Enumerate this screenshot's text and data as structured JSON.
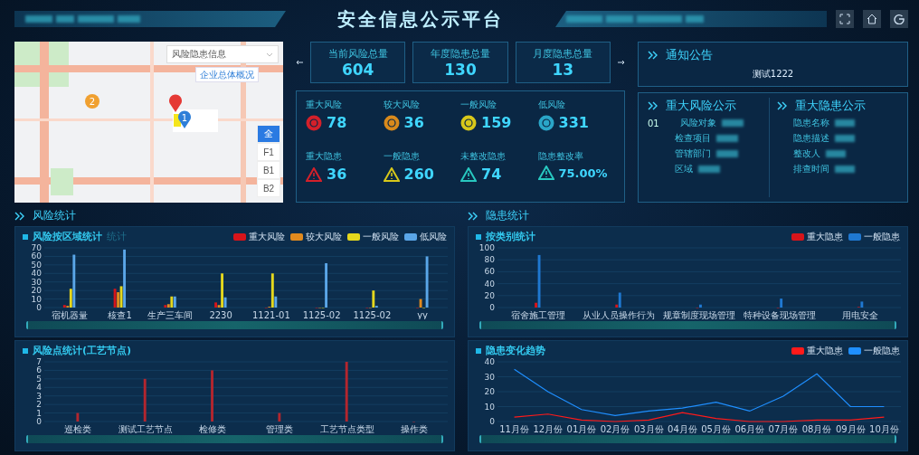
{
  "header": {
    "title": "安全信息公示平台"
  },
  "map": {
    "layer_select": {
      "value": "风险隐患信息"
    },
    "overview_button": "企业总体概况",
    "markers": [
      {
        "kind": "cluster",
        "label": "2",
        "color": "#f0a030"
      },
      {
        "kind": "pin",
        "color": "#e53935"
      },
      {
        "kind": "pin",
        "label": "1",
        "color": "#2f7fd8"
      }
    ],
    "floors": [
      {
        "label": "全",
        "selected": true
      },
      {
        "label": "F1",
        "selected": false
      },
      {
        "label": "B1",
        "selected": false
      },
      {
        "label": "B2",
        "selected": false
      }
    ]
  },
  "totals": [
    {
      "label": "当前风险总量",
      "value": "604"
    },
    {
      "label": "年度隐患总量",
      "value": "130"
    },
    {
      "label": "月度隐患总量",
      "value": "13"
    }
  ],
  "stats": [
    {
      "label": "重大风险",
      "value": "78",
      "kind": "badge",
      "color": "#d4202a"
    },
    {
      "label": "较大风险",
      "value": "36",
      "kind": "badge",
      "color": "#d98a1c"
    },
    {
      "label": "一般风险",
      "value": "159",
      "kind": "badge",
      "color": "#d8c81a"
    },
    {
      "label": "低风险",
      "value": "331",
      "kind": "badge",
      "color": "#2aa6c8"
    },
    {
      "label": "重大隐患",
      "value": "36",
      "kind": "triangle",
      "color": "#d4202a"
    },
    {
      "label": "一般隐患",
      "value": "260",
      "kind": "triangle",
      "color": "#d8c81a"
    },
    {
      "label": "未整改隐患",
      "value": "74",
      "kind": "triangle",
      "color": "#28c8c0"
    },
    {
      "label": "隐患整改率",
      "value": "75.00%",
      "kind": "triangle",
      "color": "#28c8c0"
    }
  ],
  "notice": {
    "title": "通知公告",
    "text": "测试1222"
  },
  "major_risk": {
    "title": "重大风险公示",
    "index": "01",
    "fields": [
      "风险对象",
      "检查项目",
      "管辖部门",
      "区域"
    ]
  },
  "major_hazard": {
    "title": "重大隐患公示",
    "fields": [
      "隐患名称",
      "隐患描述",
      "整改人",
      "排查时间"
    ]
  },
  "sections": [
    {
      "title": "风险统计",
      "panels": [
        {
          "title": "风险按区域统计",
          "title_suffix": "统计",
          "slider": {
            "level": 1
          },
          "chart_data": {
            "type": "bar",
            "grid": true,
            "categories": [
              "宿机器量",
              "核查1",
              "生产三车间",
              "2230",
              "1121-01",
              "1125-02",
              "1125-02",
              "yy"
            ],
            "ylim": [
              0,
              70
            ],
            "yticks": [
              0,
              10,
              20,
              30,
              40,
              50,
              60,
              70
            ],
            "series": [
              {
                "name": "重大风险",
                "color": "#d7141a",
                "values": [
                  3,
                  22,
                  3,
                  6,
                  0,
                  0,
                  0,
                  0
                ]
              },
              {
                "name": "较大风险",
                "color": "#e08a1e",
                "values": [
                  2,
                  18,
                  4,
                  3,
                  1,
                  0,
                  0,
                  10
                ]
              },
              {
                "name": "一般风险",
                "color": "#e5d81d",
                "values": [
                  22,
                  25,
                  13,
                  40,
                  40,
                  0,
                  20,
                  0
                ]
              },
              {
                "name": "低风险",
                "color": "#5aa6e8",
                "values": [
                  62,
                  68,
                  13,
                  12,
                  13,
                  52,
                  2,
                  60
                ]
              }
            ]
          }
        },
        {
          "title": "风险点统计(工艺节点)",
          "slider": {
            "level": 1
          },
          "chart_data": {
            "type": "bar",
            "grid": true,
            "categories": [
              "巡检类",
              "测试工艺节点",
              "检修类",
              "管理类",
              "工艺节点类型",
              "操作类"
            ],
            "ylim": [
              0,
              7
            ],
            "yticks": [
              0,
              1,
              2,
              3,
              4,
              5,
              6,
              7
            ],
            "series": [
              {
                "color": "#b3262e",
                "values": [
                  1,
                  5,
                  6,
                  1,
                  7,
                  0
                ]
              }
            ]
          }
        }
      ]
    },
    {
      "title": "隐患统计",
      "panels": [
        {
          "title": "按类别统计",
          "slider": {
            "level": 1
          },
          "chart_data": {
            "type": "bar",
            "grid": true,
            "categories": [
              "宿舍施工管理",
              "从业人员操作行为",
              "规章制度现场管理",
              "特种设备现场管理",
              "用电安全"
            ],
            "ylim": [
              0,
              100
            ],
            "yticks": [
              0,
              20,
              40,
              60,
              80,
              100
            ],
            "series": [
              {
                "name": "重大隐患",
                "color": "#d7141a",
                "values": [
                  8,
                  5,
                  0,
                  0,
                  1
                ]
              },
              {
                "name": "一般隐患",
                "color": "#1f78d1",
                "values": [
                  88,
                  25,
                  5,
                  15,
                  10
                ]
              }
            ]
          }
        },
        {
          "title": "隐患变化趋势",
          "slider": {
            "level": 1
          },
          "chart_data": {
            "type": "line",
            "grid": true,
            "categories": [
              "11月份",
              "12月份",
              "01月份",
              "02月份",
              "03月份",
              "04月份",
              "05月份",
              "06月份",
              "07月份",
              "08月份",
              "09月份",
              "10月份"
            ],
            "ylim": [
              0,
              40
            ],
            "yticks": [
              0,
              10,
              20,
              30,
              40
            ],
            "series": [
              {
                "name": "重大隐患",
                "color": "#ff1a1a",
                "values": [
                  3,
                  5,
                  1,
                  0,
                  1,
                  6,
                  2,
                  0,
                  0,
                  1,
                  1,
                  3
                ]
              },
              {
                "name": "一般隐患",
                "color": "#1f8fff",
                "values": [
                  35,
                  20,
                  8,
                  4,
                  7,
                  9,
                  13,
                  7,
                  17,
                  32,
                  10,
                  10
                ]
              }
            ]
          }
        }
      ]
    }
  ]
}
